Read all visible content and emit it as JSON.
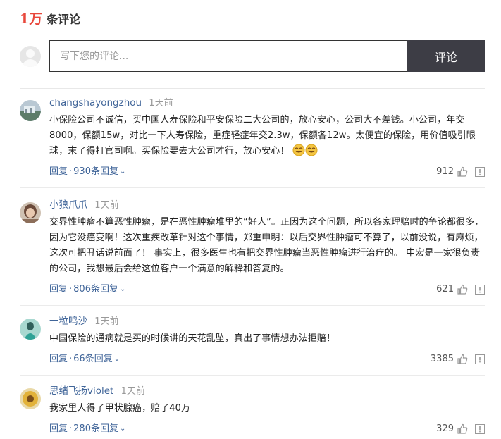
{
  "header": {
    "count": "1万",
    "suffix": "条评论"
  },
  "composer": {
    "placeholder": "写下您的评论...",
    "submit_label": "评论"
  },
  "comments": [
    {
      "username": "changshayongzhou",
      "time": "1天前",
      "text": "小保险公司不诚信，买中国人寿保险和平安保险二大公司的，放心安心，公司大不差钱。小公司，年交8000，保额15w，对比一下人寿保险，重症轻症年交2.3w，保额各12w。太便宜的保险，用价值吸引眼球，末了得打官司啊。买保险要去大公司才行，放心安心！",
      "reply_label": "回复",
      "replies_label": "930条回复",
      "likes": "912",
      "avatar_color": "#6d8fa8"
    },
    {
      "username": "小狼爪爪",
      "time": "1天前",
      "text": "交界性肿瘤不算恶性肿瘤，是在恶性肿瘤堆里的“好人”。正因为这个问题，所以各家理赔时的争论都很多，因为它没癌变啊！这次重疾改革针对这个事情，郑重申明：以后交界性肿瘤可不算了，以前没说，有麻烦，这次可把丑话说前面了！ 事实上，很多医生也有把交界性肿瘤当恶性肿瘤进行治疗的。 中宏是一家很负责的公司，我想最后会给这位客户一个满意的解释和答复的。",
      "reply_label": "回复",
      "replies_label": "806条回复",
      "likes": "621",
      "avatar_color": "#8a6d5c"
    },
    {
      "username": "一粒鸣沙",
      "time": "1天前",
      "text": "中国保险的通病就是买的时候讲的天花乱坠，真出了事情想办法拒赔！",
      "reply_label": "回复",
      "replies_label": "66条回复",
      "likes": "3385",
      "avatar_color": "#3fa39a"
    },
    {
      "username": "思绪飞扬violet",
      "time": "1天前",
      "text": "我家里人得了甲状腺癌，赔了40万",
      "reply_label": "回复",
      "replies_label": "280条回复",
      "likes": "329",
      "avatar_color": "#c9a23c"
    }
  ],
  "separator": "·"
}
